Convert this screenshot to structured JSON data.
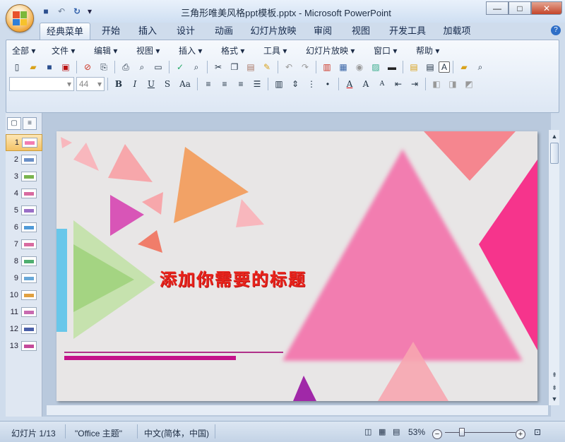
{
  "window": {
    "title": "三角形唯美风格ppt模板.pptx - Microsoft PowerPoint",
    "minimize": "—",
    "maximize": "□",
    "close": "✕"
  },
  "qat": {
    "save": "💾",
    "undo": "↶",
    "redo": "↻",
    "more": "▾"
  },
  "tabs": [
    "经典菜单",
    "开始",
    "插入",
    "设计",
    "动画",
    "幻灯片放映",
    "审阅",
    "视图",
    "开发工具",
    "加载项"
  ],
  "active_tab": "经典菜单",
  "help": "?",
  "menus": [
    "全部 ▾",
    "文件 ▾",
    "编辑 ▾",
    "视图 ▾",
    "插入 ▾",
    "格式 ▾",
    "工具 ▾",
    "幻灯片放映 ▾",
    "窗口 ▾",
    "帮助 ▾"
  ],
  "font_size": "44",
  "font_name": "",
  "toolbar2_text": {
    "bold": "B",
    "italic": "I",
    "underline": "U",
    "shadow": "S",
    "case": "Aa",
    "grow": "A",
    "shrink": "A",
    "fontcolor": "A"
  },
  "toolbar1_text": {
    "textbox": "A"
  },
  "panel_tabs": {
    "slides": "▢",
    "outline": "≡"
  },
  "slides": [
    "1",
    "2",
    "3",
    "4",
    "5",
    "6",
    "7",
    "8",
    "9",
    "10",
    "11",
    "12",
    "13"
  ],
  "selected_slide": 1,
  "slide": {
    "title": "添加你需要的标题"
  },
  "status": {
    "slide_count": "幻灯片 1/13",
    "theme": "\"Office 主题\"",
    "language": "中文(简体，中国)",
    "zoom": "53%",
    "zoom_minus": "−",
    "zoom_plus": "+"
  },
  "zoom_level_percent": 53,
  "colors": {
    "accent": "#f0a940",
    "title_red": "#e8231b",
    "pink": "#f27db0",
    "magenta": "#c4128a"
  }
}
